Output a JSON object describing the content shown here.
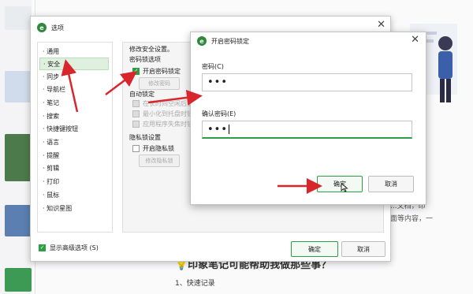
{
  "background": {
    "heading": "💡印象笔记可能帮助我做那些事？",
    "subheading": "1、快速记录",
    "side_text_1": "频...文档，印",
    "side_text_2": "页面等内容，一"
  },
  "options_dialog": {
    "title": "选项",
    "nav_items": [
      "通用",
      "安全",
      "同步",
      "导航栏",
      "笔记",
      "搜索",
      "快捷键按钮",
      "语言",
      "提醒",
      "剪辑",
      "打印",
      "鼠标",
      "知识星图"
    ],
    "selected_nav": "安全",
    "section_header": "修改安全设置。",
    "password_section": "密码锁选项",
    "enable_password_lock": "开启密码锁定",
    "change_password": "修改密码",
    "auto_lock": "自动锁定",
    "auto_lock_options": [
      "在长时间空闲后锁定",
      "最小化到托盘时锁定",
      "应用程序失焦时锁定"
    ],
    "privacy_section": "隐私锁设置",
    "enable_privacy_lock": "开启隐私锁",
    "change_privacy_lock": "修改隐私锁",
    "show_advanced": "显示高级选项 (S)",
    "ok": "确定",
    "cancel": "取消"
  },
  "password_dialog": {
    "title": "开启密码锁定",
    "password_label": "密码(C)",
    "password_value": "•••",
    "confirm_label": "确认密码(E)",
    "confirm_value": "•••",
    "ok": "确定",
    "cancel": "取消"
  },
  "colors": {
    "accent": "#2c9f45",
    "annotation_arrow": "#d9262c"
  }
}
